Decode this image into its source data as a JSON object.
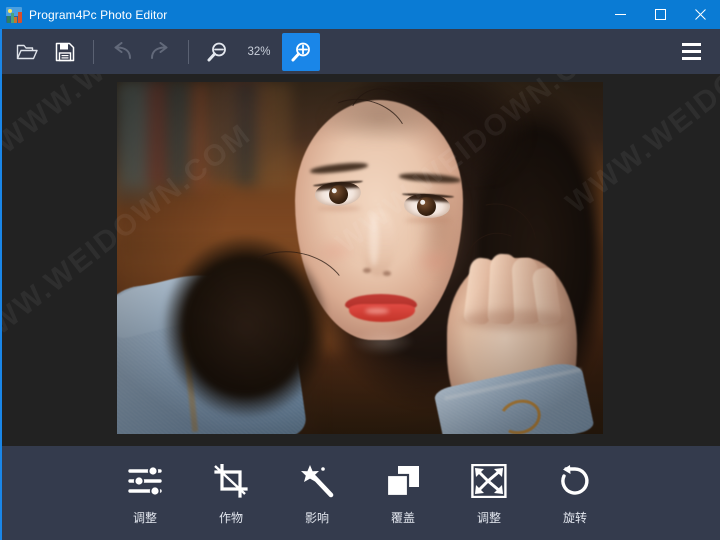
{
  "window": {
    "title": "Program4Pc Photo Editor",
    "app_icon": "photo-app-icon",
    "controls": {
      "minimize": "minimize-icon",
      "maximize": "maximize-icon",
      "close": "close-icon"
    },
    "titlebar_color": "#0a7bd4",
    "chrome_color": "#343b4d",
    "accent_color": "#1a86e8",
    "canvas_color": "#222222"
  },
  "toolbar": {
    "open_icon": "folder-open-icon",
    "save_icon": "save-icon",
    "undo_icon": "undo-icon",
    "redo_icon": "redo-icon",
    "zoom_out_icon": "zoom-out-icon",
    "zoom_in_icon": "zoom-in-icon",
    "menu_icon": "hamburger-menu-icon",
    "zoom_level": "32%",
    "undo_enabled": false,
    "redo_enabled": false,
    "zoom_in_active": true
  },
  "canvas": {
    "watermark": "WWW.WEIDOWN.COM",
    "image_description": "portrait-photo-woman-denim-jacket"
  },
  "bottom_tools": [
    {
      "label": "调整",
      "icon": "sliders-adjust-icon"
    },
    {
      "label": "作物",
      "icon": "crop-icon"
    },
    {
      "label": "影响",
      "icon": "magic-wand-effects-icon"
    },
    {
      "label": "覆盖",
      "icon": "overlay-layers-icon"
    },
    {
      "label": "调整",
      "icon": "resize-arrows-icon"
    },
    {
      "label": "旋转",
      "icon": "rotate-icon"
    }
  ]
}
